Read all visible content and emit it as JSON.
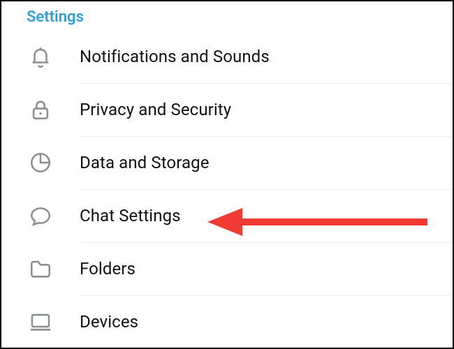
{
  "header": {
    "title": "Settings"
  },
  "items": [
    {
      "id": "notifications",
      "label": "Notifications and Sounds",
      "icon": "bell-icon"
    },
    {
      "id": "privacy",
      "label": "Privacy and Security",
      "icon": "lock-icon"
    },
    {
      "id": "data",
      "label": "Data and Storage",
      "icon": "pie-icon"
    },
    {
      "id": "chat",
      "label": "Chat Settings",
      "icon": "chat-icon"
    },
    {
      "id": "folders",
      "label": "Folders",
      "icon": "folder-icon"
    },
    {
      "id": "devices",
      "label": "Devices",
      "icon": "device-icon"
    }
  ],
  "annotation": {
    "target": "chat",
    "type": "arrow",
    "color": "#ef3b33"
  }
}
